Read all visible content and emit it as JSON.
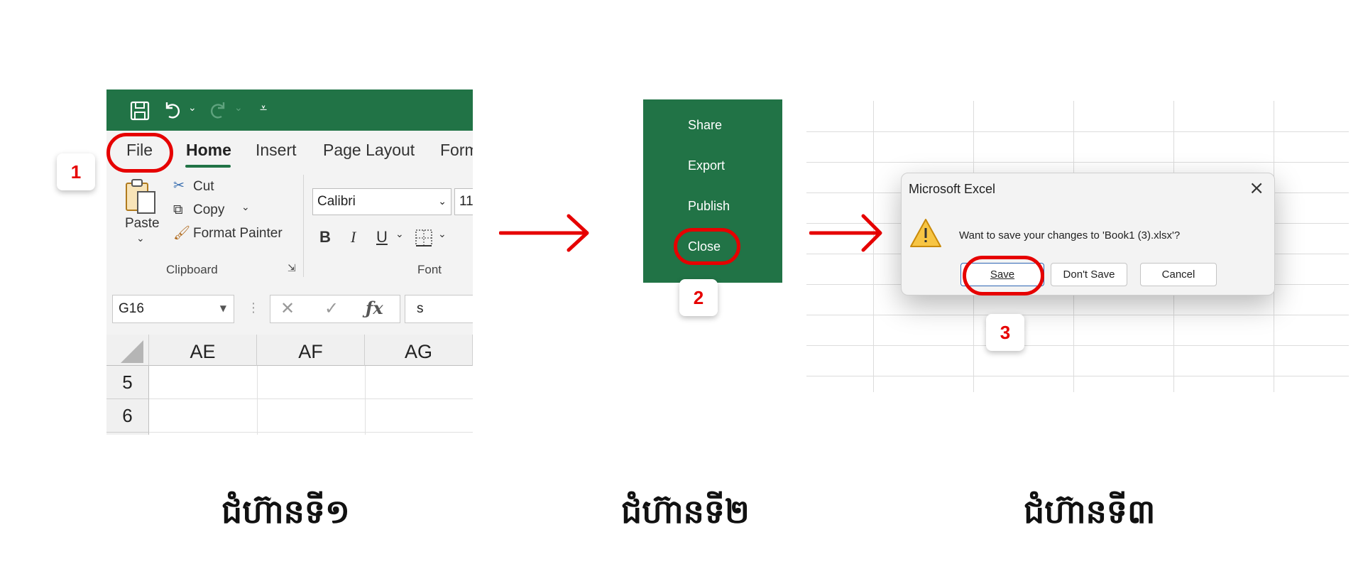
{
  "step1": {
    "tabs": [
      "File",
      "Home",
      "Insert",
      "Page Layout",
      "Form"
    ],
    "clipboard": {
      "paste": "Paste",
      "cut": "Cut",
      "copy": "Copy",
      "format_painter": "Format Painter",
      "group_label": "Clipboard"
    },
    "font": {
      "font_name": "Calibri",
      "font_size": "11",
      "bold": "B",
      "italic": "I",
      "underline": "U",
      "group_label": "Font"
    },
    "name_box": "G16",
    "formula_value": "s",
    "columns": [
      "AE",
      "AF",
      "AG"
    ],
    "rows": [
      "5",
      "6"
    ],
    "badge": "1"
  },
  "step2": {
    "menu": [
      "Share",
      "Export",
      "Publish",
      "Close"
    ],
    "badge": "2"
  },
  "step3": {
    "dialog": {
      "title": "Microsoft Excel",
      "message": "Want to save your changes to 'Book1 (3).xlsx'?",
      "buttons": [
        "Save",
        "Don't Save",
        "Cancel"
      ]
    },
    "badge": "3"
  },
  "captions": [
    "ជំហ៊ានទី១",
    "ជំហ៊ានទី២",
    "ជំហ៊ានទី៣"
  ],
  "colors": {
    "excel_green": "#217346",
    "annotation_red": "#e60000"
  },
  "icons": [
    "save-icon",
    "undo-icon",
    "redo-icon",
    "customize-qat-icon",
    "paste-icon",
    "cut-icon",
    "copy-icon",
    "format-painter-icon",
    "borders-icon",
    "cancel-icon",
    "enter-icon",
    "fx-icon",
    "warning-icon",
    "close-icon",
    "arrow-right-icon"
  ]
}
